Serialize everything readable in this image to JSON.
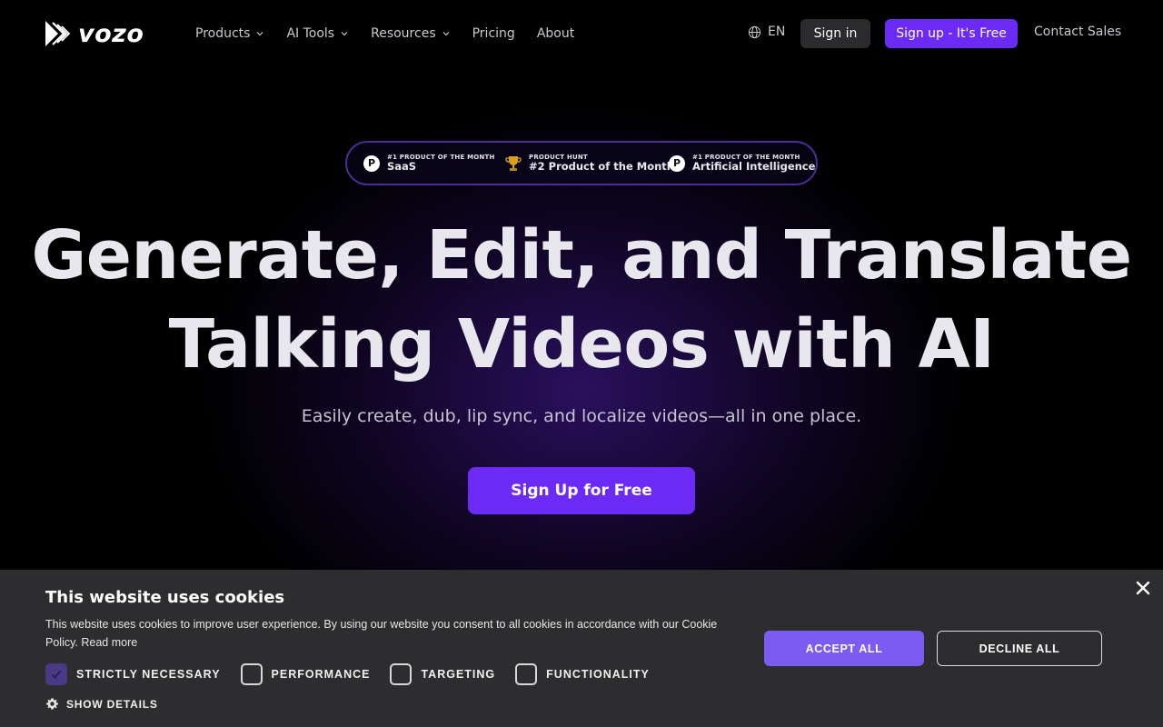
{
  "brand": {
    "name": "vozo",
    "logo_icon": "vozo-logo-icon"
  },
  "nav": {
    "items": [
      {
        "label": "Products",
        "has_dropdown": true
      },
      {
        "label": "AI Tools",
        "has_dropdown": true
      },
      {
        "label": "Resources",
        "has_dropdown": true
      },
      {
        "label": "Pricing",
        "has_dropdown": false
      },
      {
        "label": "About",
        "has_dropdown": false
      }
    ],
    "language": "EN",
    "sign_in": "Sign in",
    "sign_up": "Sign up - It's Free",
    "contact_sales": "Contact Sales"
  },
  "badges": [
    {
      "icon": "producthunt-icon",
      "kicker": "#1 PRODUCT OF THE MONTH",
      "title": "SaaS"
    },
    {
      "icon": "trophy-icon",
      "kicker": "PRODUCT HUNT",
      "title": "#2 Product of the Month"
    },
    {
      "icon": "producthunt-icon",
      "kicker": "#1 PRODUCT OF THE MONTH",
      "title": "Artificial Intelligence"
    }
  ],
  "hero": {
    "headline_line1": "Generate, Edit, and Translate",
    "headline_line2": "Talking Videos with AI",
    "subheadline": "Easily create, dub, lip sync, and localize videos—all in one place.",
    "cta": "Sign Up for Free"
  },
  "cookie_banner": {
    "title": "This website uses cookies",
    "body": "This website uses cookies to improve user experience. By using our website you consent to all cookies in accordance with our Cookie Policy.",
    "read_more": "Read more",
    "categories": [
      {
        "label": "STRICTLY NECESSARY",
        "checked": true
      },
      {
        "label": "PERFORMANCE",
        "checked": false
      },
      {
        "label": "TARGETING",
        "checked": false
      },
      {
        "label": "FUNCTIONALITY",
        "checked": false
      }
    ],
    "show_details": "SHOW DETAILS",
    "accept_all": "ACCEPT ALL",
    "decline_all": "DECLINE ALL"
  },
  "colors": {
    "accent": "#6b2bf5",
    "accept_button": "#7b5cf2",
    "banner_bg": "#2d2d2f",
    "badge_border": "#4c2c98"
  }
}
